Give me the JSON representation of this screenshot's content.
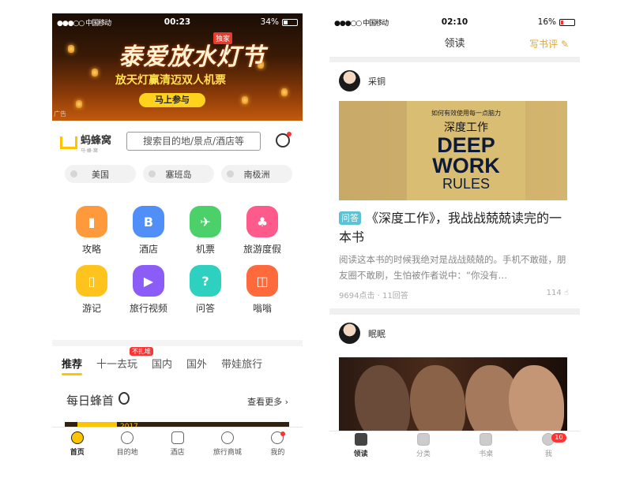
{
  "left_phone": {
    "status": {
      "carrier": "●●●○○ 中国移动",
      "time": "00:23",
      "battery": "34%"
    },
    "banner": {
      "title": "泰爱放水灯节",
      "tag": "独家",
      "subtitle": "放天灯赢清迈双人机票",
      "button": "马上参与",
      "ad_label": "广告"
    },
    "brand": {
      "name": "蚂蜂窝",
      "sub": "马·蜂·窝"
    },
    "search_placeholder": "搜索目的地/景点/酒店等",
    "chips": [
      "美国",
      "塞班岛",
      "南极洲"
    ],
    "categories": [
      {
        "label": "攻略",
        "color": "#ff9a3c"
      },
      {
        "label": "酒店",
        "color": "#4f8ff7"
      },
      {
        "label": "机票",
        "color": "#4cd06a"
      },
      {
        "label": "旅游度假",
        "color": "#ff5a8c"
      },
      {
        "label": "游记",
        "color": "#ffc31e"
      },
      {
        "label": "旅行视频",
        "color": "#8b5cf6"
      },
      {
        "label": "问答",
        "color": "#2ed0c0"
      },
      {
        "label": "嗡嗡",
        "color": "#ff6a3c"
      }
    ],
    "tabs": [
      "推荐",
      "十一去玩",
      "国内",
      "国外",
      "带娃旅行"
    ],
    "hot_badge": "不扎堆",
    "daily_title": "每日蜂首",
    "see_more": "查看更多 ›",
    "strip_year": "2017",
    "nav": [
      "首页",
      "目的地",
      "酒店",
      "旅行商城",
      "我的"
    ]
  },
  "right_phone": {
    "status": {
      "carrier": "●●●○○ 中国移动",
      "time": "02:10",
      "battery": "16%"
    },
    "header_title": "领读",
    "write_review": "写书评",
    "post1": {
      "user": "采铜",
      "book_cn_small": "如何有效使用每一点脑力",
      "book_cn": "深度工作",
      "book_en1": "DEEP",
      "book_en2": "WORK",
      "book_en3": "RULES",
      "tag": "问答",
      "title": "《深度工作》，我战战兢兢读完的一本书",
      "excerpt": "阅读这本书的时候我绝对是战战兢兢的。手机不敢碰，朋友圈不敢刷，生怕被作者说中：“你没有…",
      "meta": "9694点击 · 11回答",
      "likes": "114"
    },
    "post2": {
      "user": "眠眠"
    },
    "nav": [
      "领读",
      "分类",
      "书桌",
      "我"
    ],
    "me_badge": "10"
  }
}
